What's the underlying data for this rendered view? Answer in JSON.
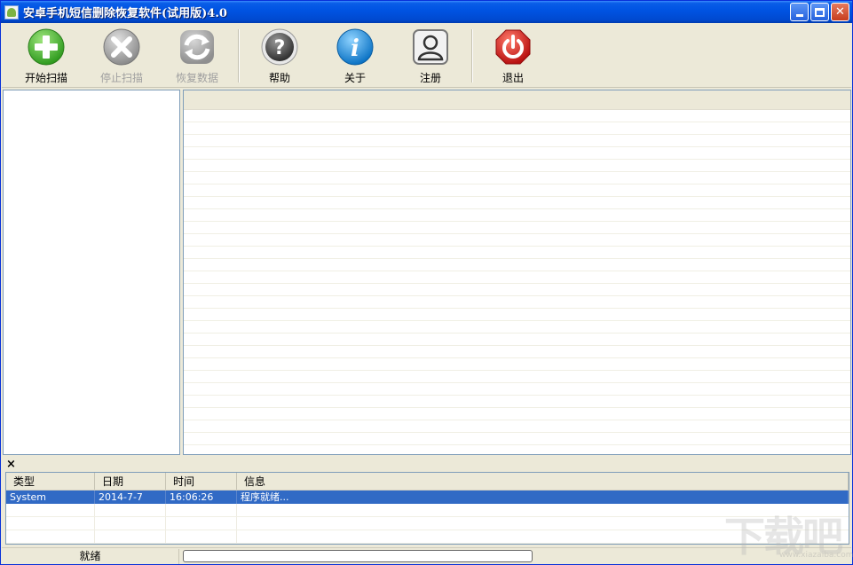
{
  "window": {
    "title": "安卓手机短信删除恢复软件(试用版)4.0",
    "icon": "android-icon"
  },
  "title_controls": {
    "minimize": "minimize-icon",
    "maximize": "maximize-icon",
    "close_glyph": "✕"
  },
  "toolbar": {
    "items": [
      {
        "label": "开始扫描",
        "icon": "plus-circle-icon",
        "color": "#3cae2c",
        "enabled": true
      },
      {
        "label": "停止扫描",
        "icon": "x-circle-icon",
        "color": "#9a9a9a",
        "enabled": false
      },
      {
        "label": "恢复数据",
        "icon": "refresh-icon",
        "color": "#9a9a9a",
        "enabled": false
      },
      {
        "label": "帮助",
        "icon": "question-icon",
        "color": "#555555",
        "enabled": true
      },
      {
        "label": "关于",
        "icon": "info-icon",
        "color": "#1e8fd8",
        "enabled": true
      },
      {
        "label": "注册",
        "icon": "user-icon",
        "color": "#666666",
        "enabled": true
      },
      {
        "label": "退出",
        "icon": "power-icon",
        "color": "#d42020",
        "enabled": true
      }
    ]
  },
  "log": {
    "close_glyph": "×",
    "columns": [
      "类型",
      "日期",
      "时间",
      "信息"
    ],
    "rows": [
      {
        "type": "System",
        "date": "2014-7-7",
        "time": "16:06:26",
        "message": "程序就绪..."
      }
    ]
  },
  "status": {
    "text": "就绪",
    "progress": 0
  },
  "watermark": {
    "text": "下载吧",
    "url": "www.xiazaiba.com"
  },
  "colors": {
    "titlebar": "#0054e3",
    "selection": "#316ac5",
    "face": "#ece9d8"
  }
}
